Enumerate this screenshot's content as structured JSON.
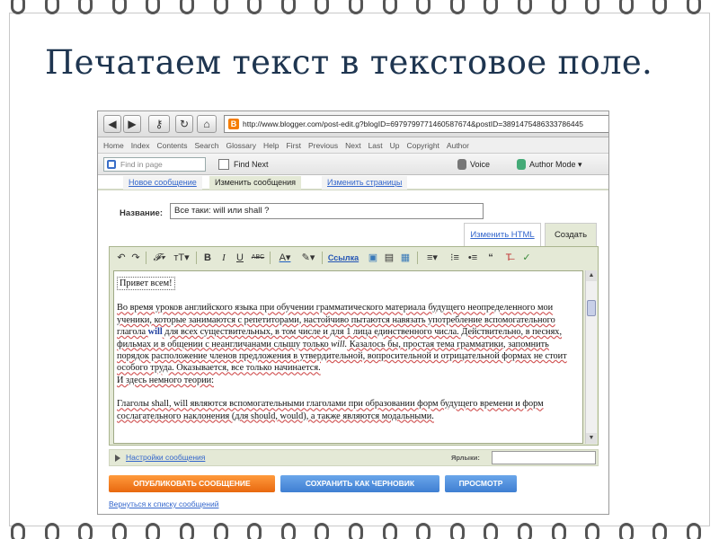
{
  "slide": {
    "title": "Печатаем текст в текстовое поле."
  },
  "browser": {
    "address": {
      "url": "http://www.blogger.com/post-edit.g?blogID=6979799771460587674&postID=3891475486333786445"
    },
    "menu": [
      "Home",
      "Index",
      "Contents",
      "Search",
      "Glossary",
      "Help",
      "First",
      "Previous",
      "Next",
      "Last",
      "Up",
      "Copyright",
      "Author"
    ],
    "find": {
      "placeholder": "Find in page",
      "find_next": "Find Next",
      "voice": "Voice",
      "author_mode": "Author Mode"
    }
  },
  "page_tabs": {
    "new_post": "Новое сообщение",
    "edit_posts": "Изменить сообщения",
    "edit_pages": "Изменить страницы"
  },
  "post": {
    "title_label": "Название:",
    "title_value": "Все таки: will или shall ?",
    "tab_html": "Изменить HTML",
    "tab_create": "Создать",
    "toolbar": {
      "link": "Ссылка"
    },
    "body": {
      "greeting": "Привет всем!",
      "para1_a": "Во время уроков английского языка при обучении грамматического материала будущего неопределенного мои ученики, которые занимаются с репетиторами, настойчиво пытаются навязать употребление вспомогательного глагола ",
      "para1_will": "will",
      "para1_b": " для всех существительных, в том числе и для 1 лица единственного числа.  Действительно, в песнях, фильмах и в общении с неангличанами слышу только ",
      "para1_will2": "will.",
      "para1_c": "  Казалось бы, простая тема грамматики, запомнить порядок расположение членов предложения в утвердительной, вопросительной и отрицательной формах не стоит особого труда. Оказывается, все только начинается.",
      "para1_d": "И здесь немного теории:",
      "para2": "Глаголы shall, will являются вспомогательными глаголами при образовании форм будущего времени и форм сослагательного наклонения (для should, would), а также являются модальными."
    },
    "options_link": "Настройки сообщения",
    "labels_label": "Ярлыки:",
    "labels_value": "",
    "publish": "ОПУБЛИКОВАТЬ СООБЩЕНИЕ",
    "save_draft": "СОХРАНИТЬ КАК ЧЕРНОВИК",
    "preview": "ПРОСМОТР",
    "back_link": "Вернуться к списку сообщений"
  },
  "colors": {
    "title": "#1e3550",
    "publish": "#f07a1a",
    "secondary": "#4a8ad8",
    "editor_panel": "#e4e9d6",
    "link": "#3366cc"
  }
}
